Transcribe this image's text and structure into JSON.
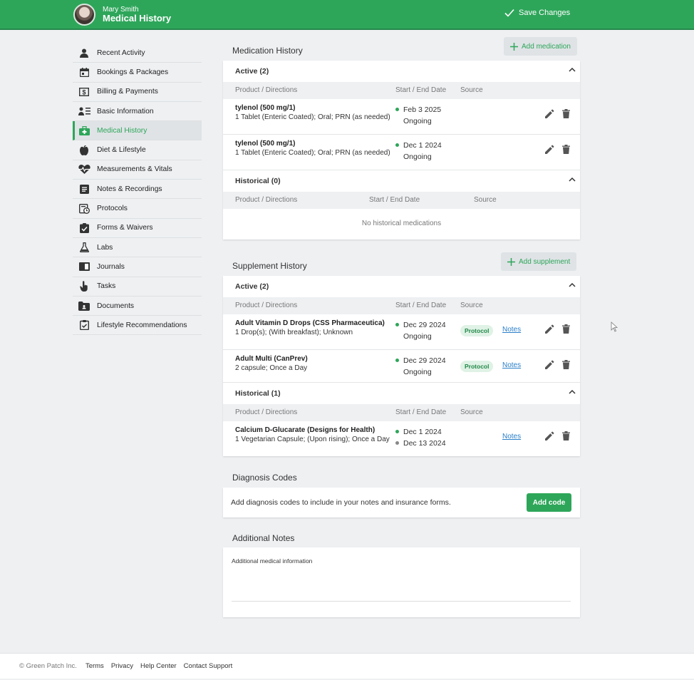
{
  "header": {
    "user_name": "Mary Smith",
    "page_title": "Medical History",
    "save_label": "Save Changes"
  },
  "sidebar": {
    "items": [
      {
        "label": "Recent Activity",
        "icon": "person-icon"
      },
      {
        "label": "Bookings & Packages",
        "icon": "calendar-icon"
      },
      {
        "label": "Billing & Payments",
        "icon": "dollar-icon"
      },
      {
        "label": "Basic Information",
        "icon": "person-list-icon"
      },
      {
        "label": "Medical History",
        "icon": "medical-kit-icon",
        "active": true
      },
      {
        "label": "Diet & Lifestyle",
        "icon": "apple-icon"
      },
      {
        "label": "Measurements & Vitals",
        "icon": "heartbeat-icon"
      },
      {
        "label": "Notes & Recordings",
        "icon": "notes-icon"
      },
      {
        "label": "Protocols",
        "icon": "protocol-icon"
      },
      {
        "label": "Forms & Waivers",
        "icon": "clipboard-check-icon"
      },
      {
        "label": "Labs",
        "icon": "flask-icon"
      },
      {
        "label": "Journals",
        "icon": "journal-icon"
      },
      {
        "label": "Tasks",
        "icon": "tasks-icon"
      },
      {
        "label": "Documents",
        "icon": "folder-icon"
      },
      {
        "label": "Lifestyle Recommendations",
        "icon": "checklist-icon"
      }
    ]
  },
  "medication": {
    "title": "Medication History",
    "add_label": "Add medication",
    "active_header": "Active (2)",
    "historical_header": "Historical (0)",
    "col_product": "Product / Directions",
    "col_dates": "Start / End Date",
    "col_source": "Source",
    "active": [
      {
        "name": "tylenol (500 mg/1)",
        "directions": "1 Tablet (Enteric Coated); Oral; PRN (as needed)",
        "start": "Feb 3 2025",
        "end": "Ongoing"
      },
      {
        "name": "tylenol (500 mg/1)",
        "directions": "1 Tablet (Enteric Coated); Oral; PRN (as needed)",
        "start": "Dec 1 2024",
        "end": "Ongoing"
      }
    ],
    "historical_empty": "No historical medications"
  },
  "supplement": {
    "title": "Supplement History",
    "add_label": "Add supplement",
    "active_header": "Active (2)",
    "historical_header": "Historical (1)",
    "col_product": "Product / Directions",
    "col_dates": "Start / End Date",
    "col_source": "Source",
    "active": [
      {
        "name": "Adult Vitamin D Drops (CSS Pharmaceutica)",
        "directions": "1 Drop(s); (With breakfast); Unknown",
        "start": "Dec 29 2024",
        "end": "Ongoing",
        "source": "Protocol",
        "notes": "Notes"
      },
      {
        "name": "Adult Multi (CanPrev)",
        "directions": "2 capsule; Once a Day",
        "start": "Dec 29 2024",
        "end": "Ongoing",
        "source": "Protocol",
        "notes": "Notes"
      }
    ],
    "historical": [
      {
        "name": "Calcium D-Glucarate (Designs for Health)",
        "directions": "1 Vegetarian Capsule; (Upon rising); Once a Day",
        "start": "Dec 1 2024",
        "end": "Dec 13 2024",
        "notes": "Notes"
      }
    ]
  },
  "diagnosis": {
    "title": "Diagnosis Codes",
    "text": "Add diagnosis codes to include in your notes and insurance forms.",
    "button": "Add code"
  },
  "additional_notes": {
    "title": "Additional Notes",
    "placeholder": "Additional medical information"
  },
  "footer": {
    "copyright": "© Green Patch Inc.",
    "links": [
      "Terms",
      "Privacy",
      "Help Center",
      "Contact Support"
    ]
  },
  "colors": {
    "brand": "#2ea65a",
    "link": "#2a7fc9"
  }
}
